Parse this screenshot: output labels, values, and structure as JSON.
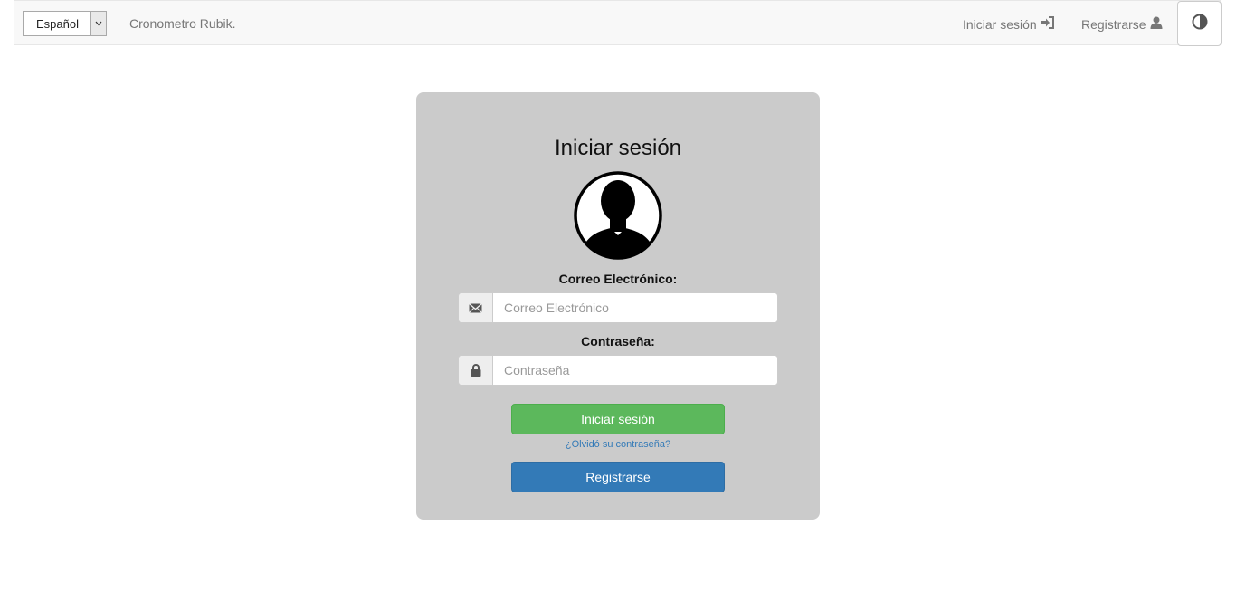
{
  "navbar": {
    "language": "Español",
    "brand": "Cronometro Rubik.",
    "login_label": "Iniciar sesión",
    "register_label": "Registrarse",
    "icons": {
      "dropdown": "chevron-down-icon",
      "login": "sign-in-icon",
      "register": "user-icon",
      "theme": "contrast-icon"
    }
  },
  "login": {
    "title": "Iniciar sesión",
    "email_label": "Correo Electrónico:",
    "email_placeholder": "Correo Electrónico",
    "email_value": "",
    "password_label": "Contraseña:",
    "password_placeholder": "Contraseña",
    "password_value": "",
    "submit_label": "Iniciar sesión",
    "forgot_label": "¿Olvidó su contraseña?",
    "register_label": "Registrarse",
    "icons": {
      "email": "envelope-icon",
      "password": "lock-icon",
      "avatar": "user-avatar-icon"
    }
  },
  "colors": {
    "card_bg": "#cbcbcb",
    "success": "#5cb85c",
    "primary": "#337ab7",
    "link": "#337ab7"
  }
}
